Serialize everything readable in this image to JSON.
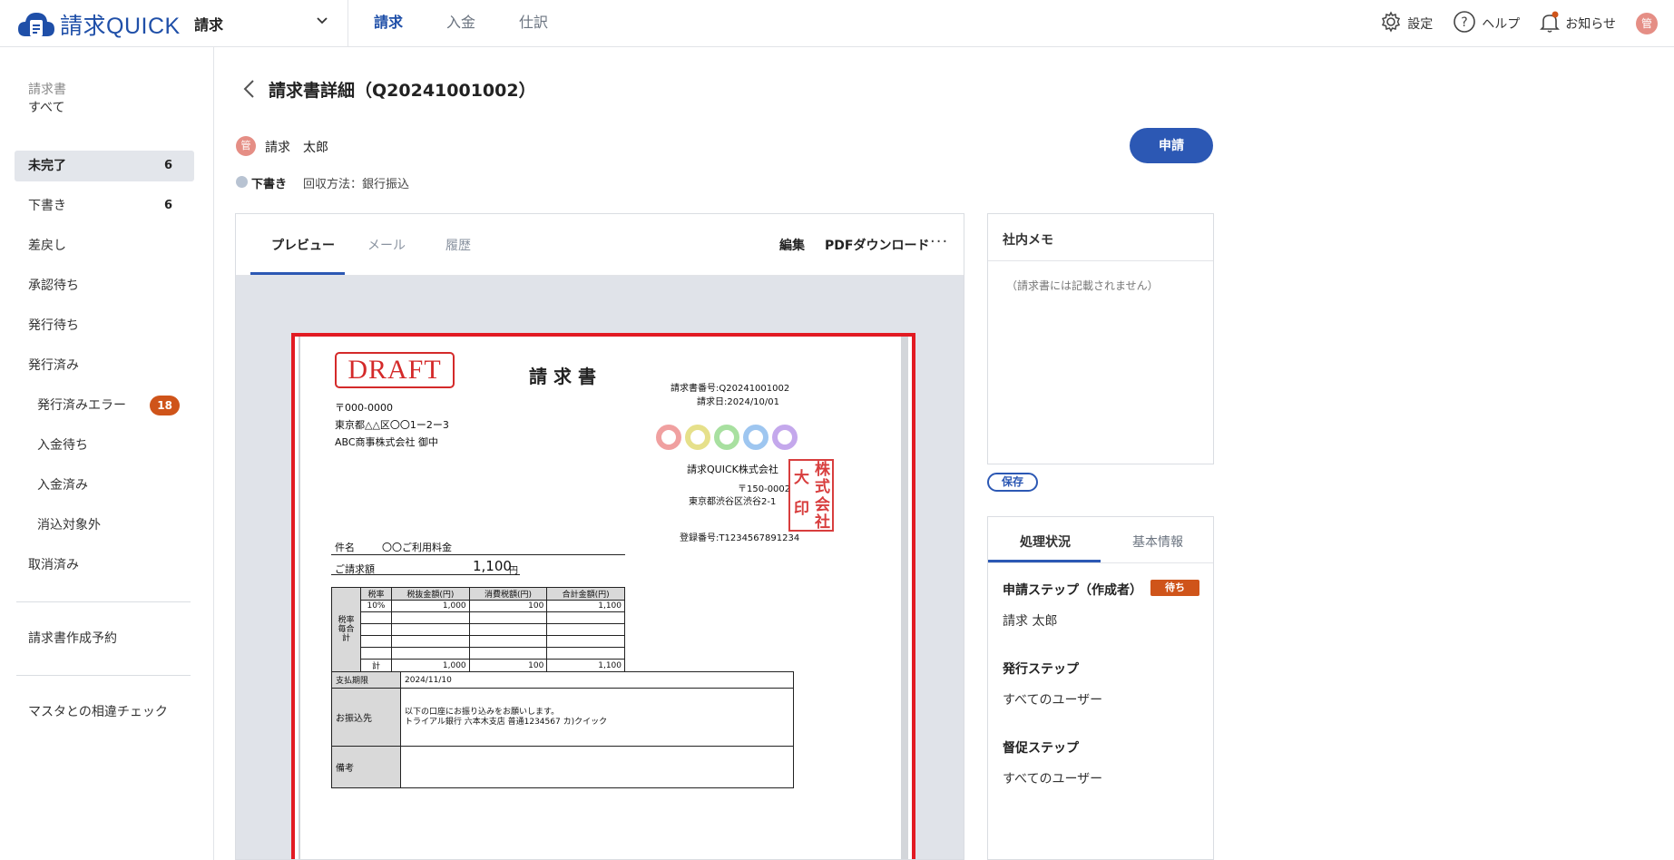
{
  "header": {
    "logo_text": "請求QUICK",
    "app_select": "請求",
    "nav_tabs": [
      "請求",
      "入金",
      "仕訳"
    ],
    "settings": "設定",
    "help": "ヘルプ",
    "notifications": "お知らせ",
    "user_initial": "管"
  },
  "sidebar": {
    "heading": "請求書",
    "items": [
      {
        "label": "すべて"
      },
      {
        "label": "未完了",
        "count": "6"
      },
      {
        "label": "下書き",
        "count": "6"
      },
      {
        "label": "差戻し"
      },
      {
        "label": "承認待ち"
      },
      {
        "label": "発行待ち"
      },
      {
        "label": "発行済み"
      },
      {
        "label": "発行済みエラー",
        "badge": "18"
      },
      {
        "label": "入金待ち"
      },
      {
        "label": "入金済み"
      },
      {
        "label": "消込対象外"
      },
      {
        "label": "取消済み"
      }
    ],
    "reservation": "請求書作成予約",
    "master_check": "マスタとの相違チェック"
  },
  "main": {
    "title": "請求書詳細（Q20241001002）",
    "user_initial": "管",
    "user_name": "請求　太郎",
    "apply_button": "申請",
    "status": "下書き",
    "collection_method": "回収方法：銀行振込"
  },
  "preview": {
    "tabs": [
      "プレビュー",
      "メール",
      "履歴"
    ],
    "edit": "編集",
    "pdf_download": "PDFダウンロード",
    "more": "···",
    "doc": {
      "draft": "DRAFT",
      "title": "請求書",
      "invoice_no": "請求書番号:Q20241001002",
      "invoice_date": "請求日:2024/10/01",
      "to_zip": "〒000-0000",
      "to_address": "東京都△△区〇〇1ー2ー3",
      "to_company": "ABC商事株式会社  御中",
      "from_company": "請求QUICK株式会社",
      "from_zip": "〒150-0002",
      "from_address": "東京都渋谷区渋谷2-1",
      "seal_text": [
        "株",
        "式",
        "会",
        "社",
        "大",
        "印"
      ],
      "reg_no": "登録番号:T1234567891234",
      "subject_label": "件名",
      "subject_value": "〇〇ご利用料金",
      "amount_label": "ご請求額",
      "amount_value": "1,100",
      "amount_unit": "円",
      "tax_table": {
        "side_label": "税率毎合計",
        "headers": [
          "税率",
          "税抜金額(円)",
          "消費税額(円)",
          "合計金額(円)"
        ],
        "rows": [
          [
            "10%",
            "1,000",
            "100",
            "1,100"
          ]
        ],
        "total_label": "計",
        "total": [
          "1,000",
          "100",
          "1,100"
        ]
      },
      "due_label": "支払期限",
      "due_value": "2024/11/10",
      "bank_label": "お振込先",
      "bank_line1": "以下の口座にお振り込みをお願いします。",
      "bank_line2": "トライアル銀行  六本木支店  普通1234567  カ)クイック",
      "notes_label": "備考"
    }
  },
  "memo": {
    "title": "社内メモ",
    "placeholder": "（請求書には記載されません）",
    "save": "保存"
  },
  "status_panel": {
    "tabs": [
      "処理状況",
      "基本情報"
    ],
    "steps": [
      {
        "title": "申請ステップ（作成者）",
        "badge": "待ち",
        "user": "請求  太郎"
      },
      {
        "title": "発行ステップ",
        "user": "すべてのユーザー"
      },
      {
        "title": "督促ステップ",
        "user": "すべてのユーザー"
      }
    ]
  },
  "colors": {
    "accent": "#2c58b4",
    "badge": "#cf541a",
    "highlight_frame": "#e21b23",
    "stamp_red": "#d42a2a"
  }
}
